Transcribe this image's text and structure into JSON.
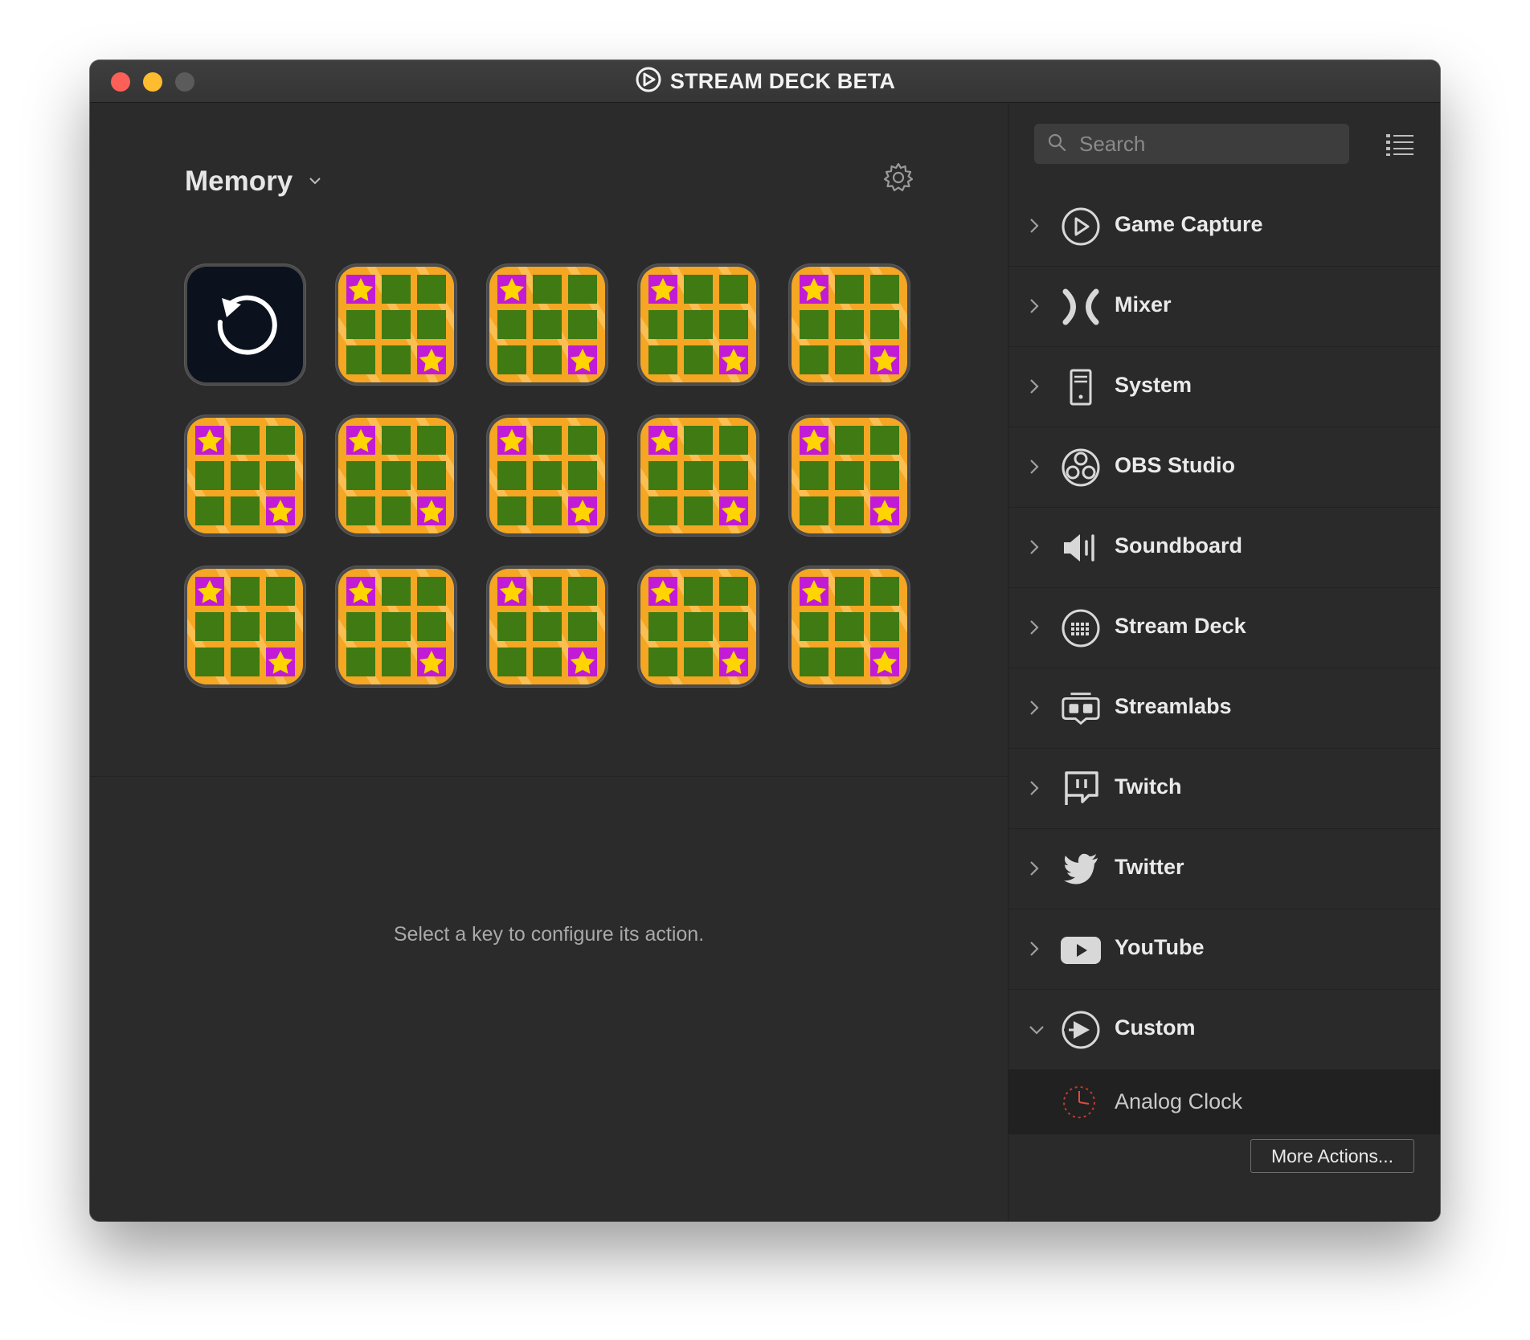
{
  "window": {
    "title": "STREAM DECK BETA"
  },
  "profile": {
    "name": "Memory"
  },
  "keys": [
    {
      "icon": "reset-icon"
    },
    {
      "icon": "memory-tile-icon"
    },
    {
      "icon": "memory-tile-icon"
    },
    {
      "icon": "memory-tile-icon"
    },
    {
      "icon": "memory-tile-icon"
    },
    {
      "icon": "memory-tile-icon"
    },
    {
      "icon": "memory-tile-icon"
    },
    {
      "icon": "memory-tile-icon"
    },
    {
      "icon": "memory-tile-icon"
    },
    {
      "icon": "memory-tile-icon"
    },
    {
      "icon": "memory-tile-icon"
    },
    {
      "icon": "memory-tile-icon"
    },
    {
      "icon": "memory-tile-icon"
    },
    {
      "icon": "memory-tile-icon"
    },
    {
      "icon": "memory-tile-icon"
    }
  ],
  "hint": "Select a key to configure its action.",
  "search": {
    "placeholder": "Search"
  },
  "categories": [
    {
      "label": "Game Capture",
      "icon": "game-capture-icon",
      "expanded": false
    },
    {
      "label": "Mixer",
      "icon": "mixer-icon",
      "expanded": false
    },
    {
      "label": "System",
      "icon": "system-icon",
      "expanded": false
    },
    {
      "label": "OBS Studio",
      "icon": "obs-icon",
      "expanded": false
    },
    {
      "label": "Soundboard",
      "icon": "soundboard-icon",
      "expanded": false
    },
    {
      "label": "Stream Deck",
      "icon": "stream-deck-icon",
      "expanded": false
    },
    {
      "label": "Streamlabs",
      "icon": "streamlabs-icon",
      "expanded": false
    },
    {
      "label": "Twitch",
      "icon": "twitch-icon",
      "expanded": false
    },
    {
      "label": "Twitter",
      "icon": "twitter-icon",
      "expanded": false
    },
    {
      "label": "YouTube",
      "icon": "youtube-icon",
      "expanded": false
    },
    {
      "label": "Custom",
      "icon": "custom-icon",
      "expanded": true
    }
  ],
  "custom_actions": [
    {
      "label": "Analog Clock",
      "icon": "analog-clock-icon"
    }
  ],
  "more_actions_label": "More Actions...",
  "colors": {
    "window_bg": "#2b2b2b",
    "tile_orange": "#f5a623",
    "tile_green": "#3f7a12",
    "tile_magenta": "#c21bd6",
    "star_yellow": "#ffd400"
  }
}
